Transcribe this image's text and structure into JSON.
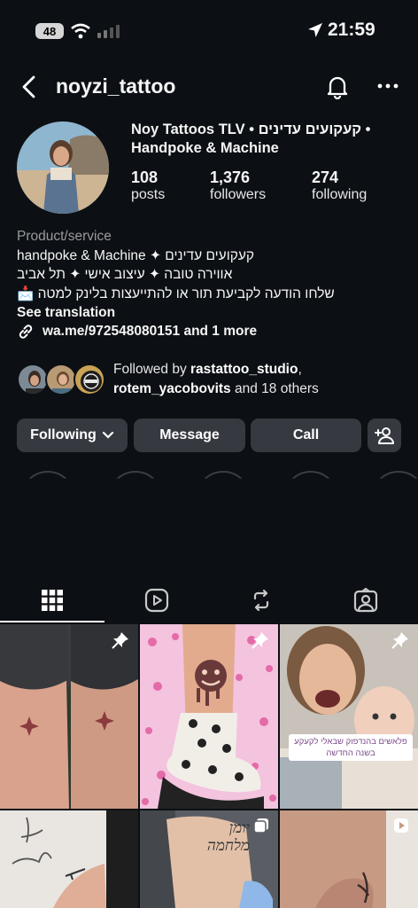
{
  "status_bar": {
    "battery": "48",
    "time": "21:59"
  },
  "header": {
    "username": "noyzi_tattoo"
  },
  "profile": {
    "display_name": "Noy Tattoos TLV • קעקועים עדינים • Handpoke & Machine",
    "stats": [
      {
        "value": "108",
        "label": "posts"
      },
      {
        "value": "1,376",
        "label": "followers"
      },
      {
        "value": "274",
        "label": "following"
      }
    ],
    "category": "Product/service",
    "bio_lines": [
      "קעקועים עדינים ✦ handpoke & Machine",
      "אווירה טובה ✦ עיצוב אישי ✦ תל אביב",
      "שלחו הודעה לקביעת תור או להתייעצות בלינק למטה 📩"
    ],
    "see_translation": "See translation",
    "link_text": "wa.me/972548080151 and 1 more"
  },
  "followed_by": {
    "prefix": "Followed by ",
    "user1": "rastattoo_studio",
    "sep": ",",
    "user2": "rotem_yacobovits",
    "suffix": " and 18 others"
  },
  "actions": {
    "following": "Following",
    "message": "Message",
    "call": "Call"
  },
  "grid": {
    "post3_caption_line1": "פלאשים בהנדפוק שבאלי לקעקע",
    "post3_caption_line2": "בשנה החדשה",
    "post4_text": "יומן מלחמה"
  },
  "colors": {
    "background": "#0c1014",
    "button": "#363a40",
    "text": "#f5f5f5",
    "secondary": "#9a9a9a"
  }
}
